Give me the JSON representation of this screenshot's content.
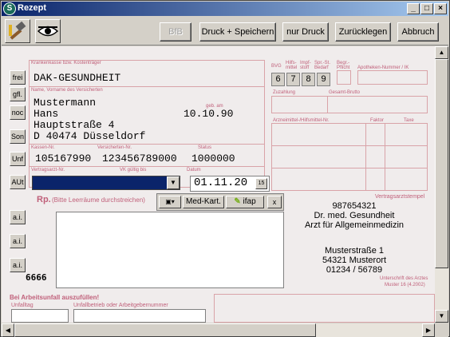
{
  "window": {
    "title": "Rezept"
  },
  "toolbar": {
    "bfb": "BfB",
    "druck_speichern": "Druck + Speichern",
    "nur_druck": "nur Druck",
    "zuruecklegen": "Zurücklegen",
    "abbruch": "Abbruch"
  },
  "side": {
    "frei": "frei",
    "gfl": "gfl.",
    "noc": "noc",
    "son": "Son",
    "unf": "Unf",
    "aut": "AUt",
    "ai": "a.i."
  },
  "form": {
    "kasse_label": "Krankenkasse bzw. Kostenträger",
    "kasse": "DAK-GESUNDHEIT",
    "name_label": "Name, Vorname des Versicherten",
    "geb_label": "geb. am",
    "name1": "Mustermann",
    "name2": "Hans",
    "street": "Hauptstraße 4",
    "city": "D 40474 Düsseldorf",
    "birth": "10.10.90",
    "kassennr_label": "Kassen-Nr.",
    "versnr_label": "Versicherten-Nr.",
    "status_label": "Status",
    "kassennr": "105167990",
    "versnr": "123456789000",
    "status": "1000000",
    "vertragsarzt_label": "Vertragsarzt-Nr.",
    "vk_label": "VK gültig bis",
    "datum_label": "Datum",
    "datum": "01.11.20",
    "datum_btn": "15",
    "bvg": "BVG",
    "hilfsmittel": "Hilfs-\nmittel",
    "impfstoff": "Impf-\nstoff",
    "sprst": "Spr.-St.\nBedarf",
    "begr": "Begr.-\nPflicht",
    "apotheke_label": "Apotheken-Nummer / IK",
    "n6": "6",
    "n7": "7",
    "n8": "8",
    "n9": "9",
    "zuzahlung": "Zuzahlung",
    "gesamt_brutto": "Gesamt-Brutto",
    "arzneimittel_label": "Arzneimittel-/Hilfsmittel-Nr.",
    "faktor": "Faktor",
    "taxe": "Taxe",
    "rp": "Rp.",
    "rp_hint": "(Bitte Leerräume durchstreichen)",
    "medkart": "Med-Kart.",
    "ifap": "ifap",
    "close_x": "x",
    "stempel_label": "Vertragsarztstempel",
    "doc1": "987654321",
    "doc2": "Dr. med. Gesundheit",
    "doc3": "Arzt für Allgemeinmedizin",
    "doc4": "Musterstraße 1",
    "doc5": "54321 Musterort",
    "doc6": "01234 / 56789",
    "unterschrift": "Unterschrift des Arztes",
    "muster": "Muster 16 (4.2002)",
    "arbeitsunfall": "Bei Arbeitsunfall auszufüllen!",
    "unfalltag": "Unfalltag",
    "unfallbetrieb": "Unfallbetrieb oder Arbeitgebernummer",
    "bbbb": "6666"
  },
  "colors": {
    "form_pink": "#d9a3a8",
    "form_bg": "#f0ecec",
    "title_blue": "#0a246a"
  }
}
